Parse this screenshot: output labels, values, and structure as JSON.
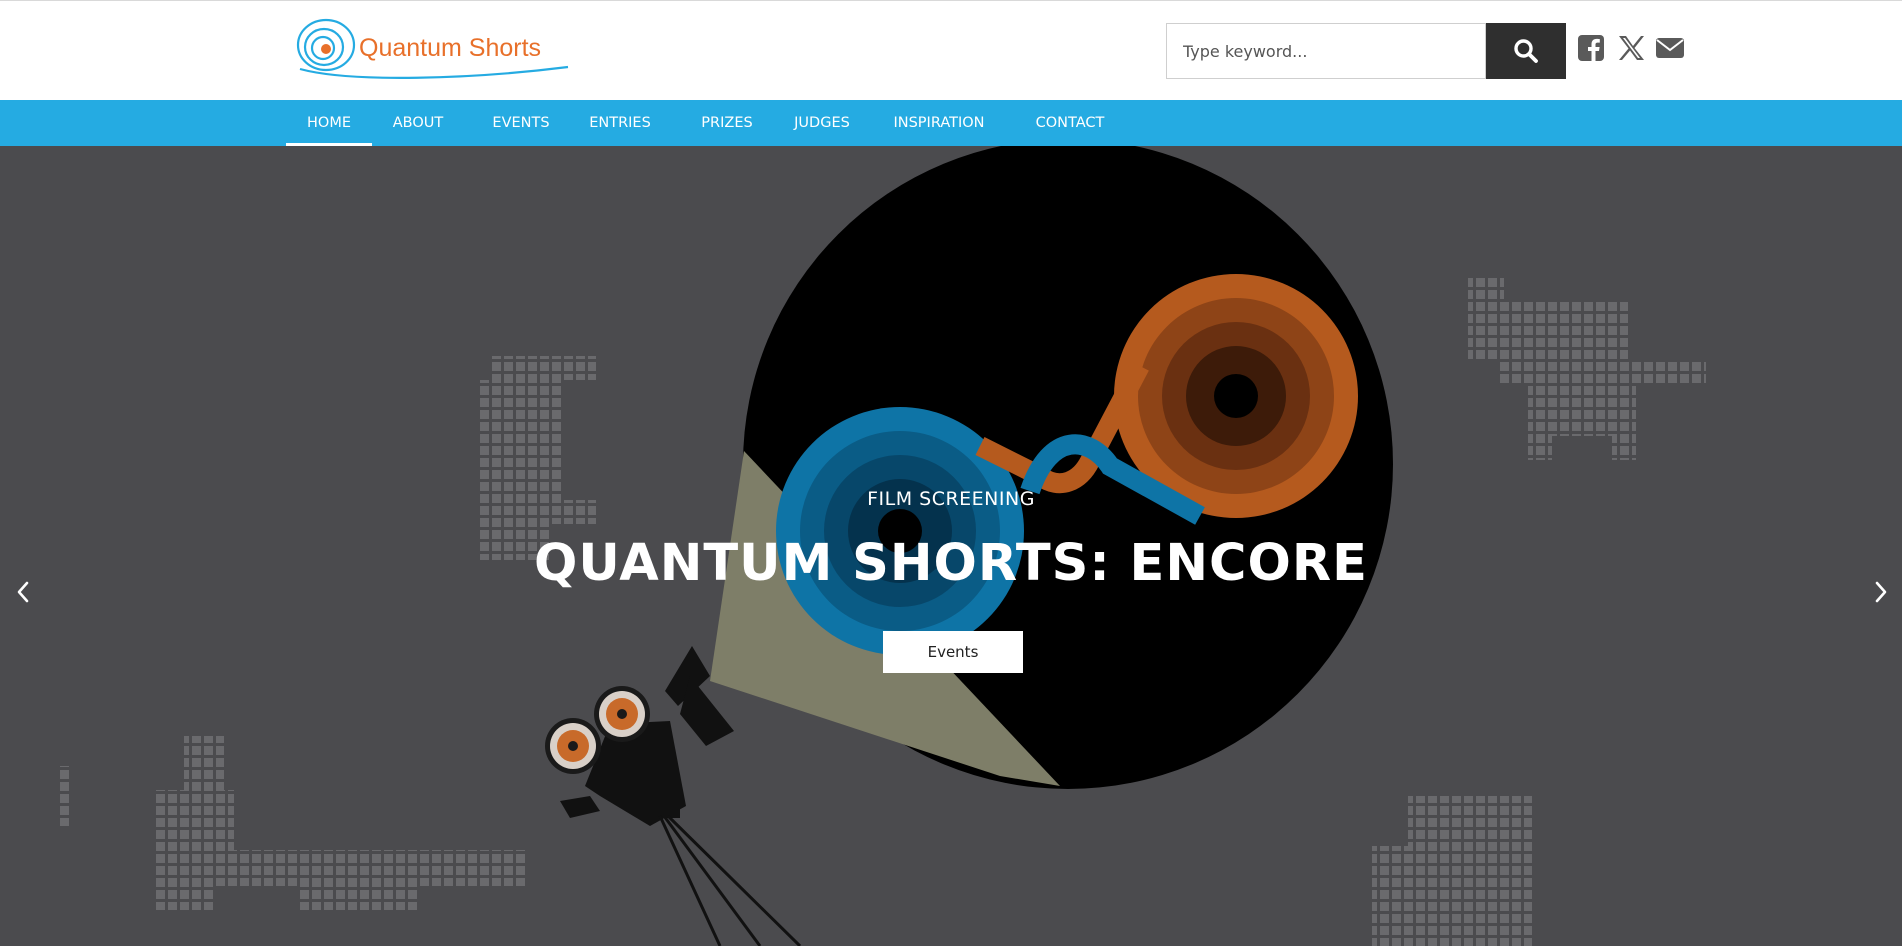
{
  "brand": {
    "name": "Quantum Shorts",
    "logo_icon": "swirl-logo-icon",
    "orange": "#e8702a",
    "blue": "#25abe2"
  },
  "search": {
    "placeholder": "Type keyword...",
    "value": "",
    "button_icon": "search-icon"
  },
  "social": [
    {
      "name": "facebook",
      "icon": "facebook-icon"
    },
    {
      "name": "x",
      "icon": "x-icon"
    },
    {
      "name": "email",
      "icon": "envelope-icon"
    }
  ],
  "nav": {
    "items": [
      {
        "label": "HOME",
        "active": true
      },
      {
        "label": "ABOUT",
        "active": false
      },
      {
        "label": "EVENTS",
        "active": false
      },
      {
        "label": "ENTRIES",
        "active": false
      },
      {
        "label": "PRIZES",
        "active": false
      },
      {
        "label": "JUDGES",
        "active": false
      },
      {
        "label": "INSPIRATION",
        "active": false
      },
      {
        "label": "CONTACT",
        "active": false
      }
    ]
  },
  "hero": {
    "subtitle": "FILM SCREENING",
    "title": "QUANTUM SHORTS: ENCORE",
    "button_label": "Events",
    "prev_icon": "chevron-left-icon",
    "next_icon": "chevron-right-icon",
    "background": "#4b4b4e"
  }
}
